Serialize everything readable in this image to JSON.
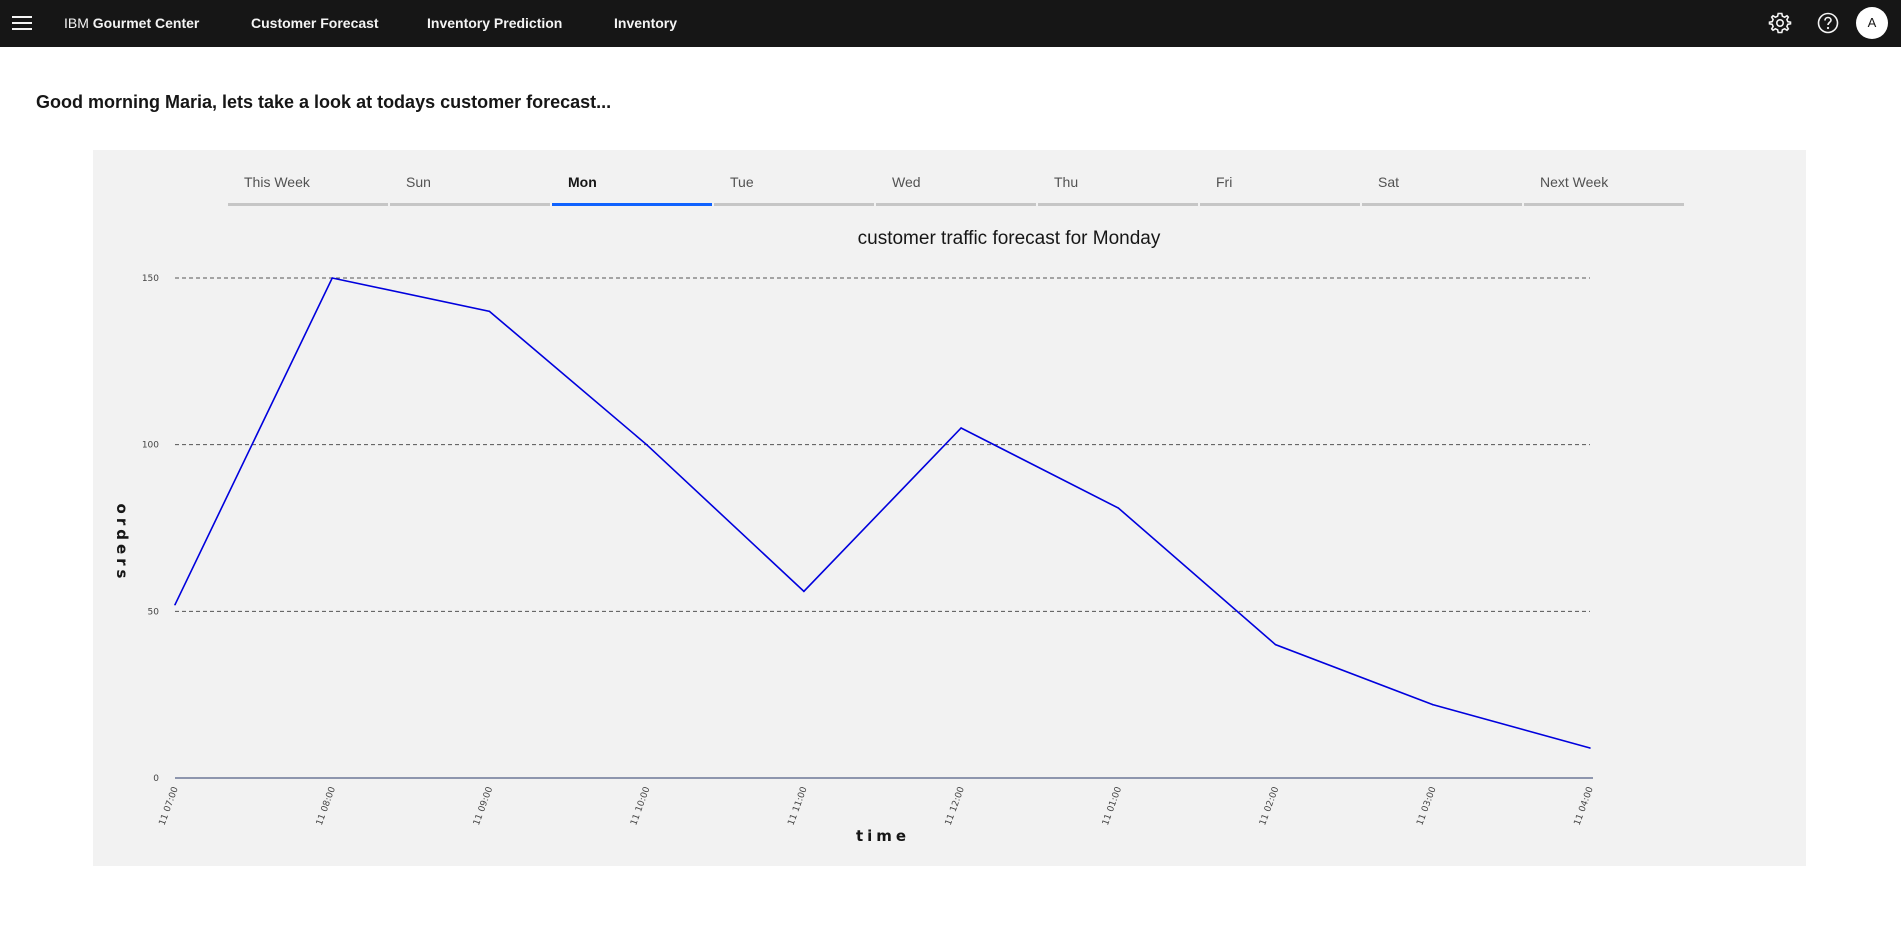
{
  "header": {
    "brand_prefix": "IBM",
    "brand_name": "Gourmet Center",
    "nav": [
      "Customer Forecast",
      "Inventory Prediction",
      "Inventory"
    ],
    "menu_icon": "hamburger-menu-icon",
    "settings_icon": "gear-icon",
    "help_icon": "help-icon",
    "avatar_initial": "A"
  },
  "greeting": "Good morning Maria, lets take a look at todays customer forecast...",
  "tabs": [
    "This Week",
    "Sun",
    "Mon",
    "Tue",
    "Wed",
    "Thu",
    "Fri",
    "Sat",
    "Next Week"
  ],
  "active_tab": 2,
  "colors": {
    "accent": "#0f62fe",
    "line": "#0000dd",
    "header_bg": "#161616",
    "panel_bg": "#f2f2f2"
  },
  "chart_data": {
    "type": "line",
    "title": "customer traffic forecast for Monday",
    "xlabel": "time",
    "ylabel": "orders",
    "categories": [
      "11 07:00",
      "11 08:00",
      "11 09:00",
      "11 10:00",
      "11 11:00",
      "11 12:00",
      "11 01:00",
      "11 02:00",
      "11 03:00",
      "11 04:00"
    ],
    "series": [
      {
        "values": [
          52,
          150,
          140,
          100,
          56,
          105,
          81,
          40,
          22,
          9
        ]
      }
    ],
    "ylim": [
      0,
      150
    ],
    "yticks": [
      0,
      50,
      100,
      150
    ],
    "grid": "horizontal dashed",
    "legend": "none"
  }
}
